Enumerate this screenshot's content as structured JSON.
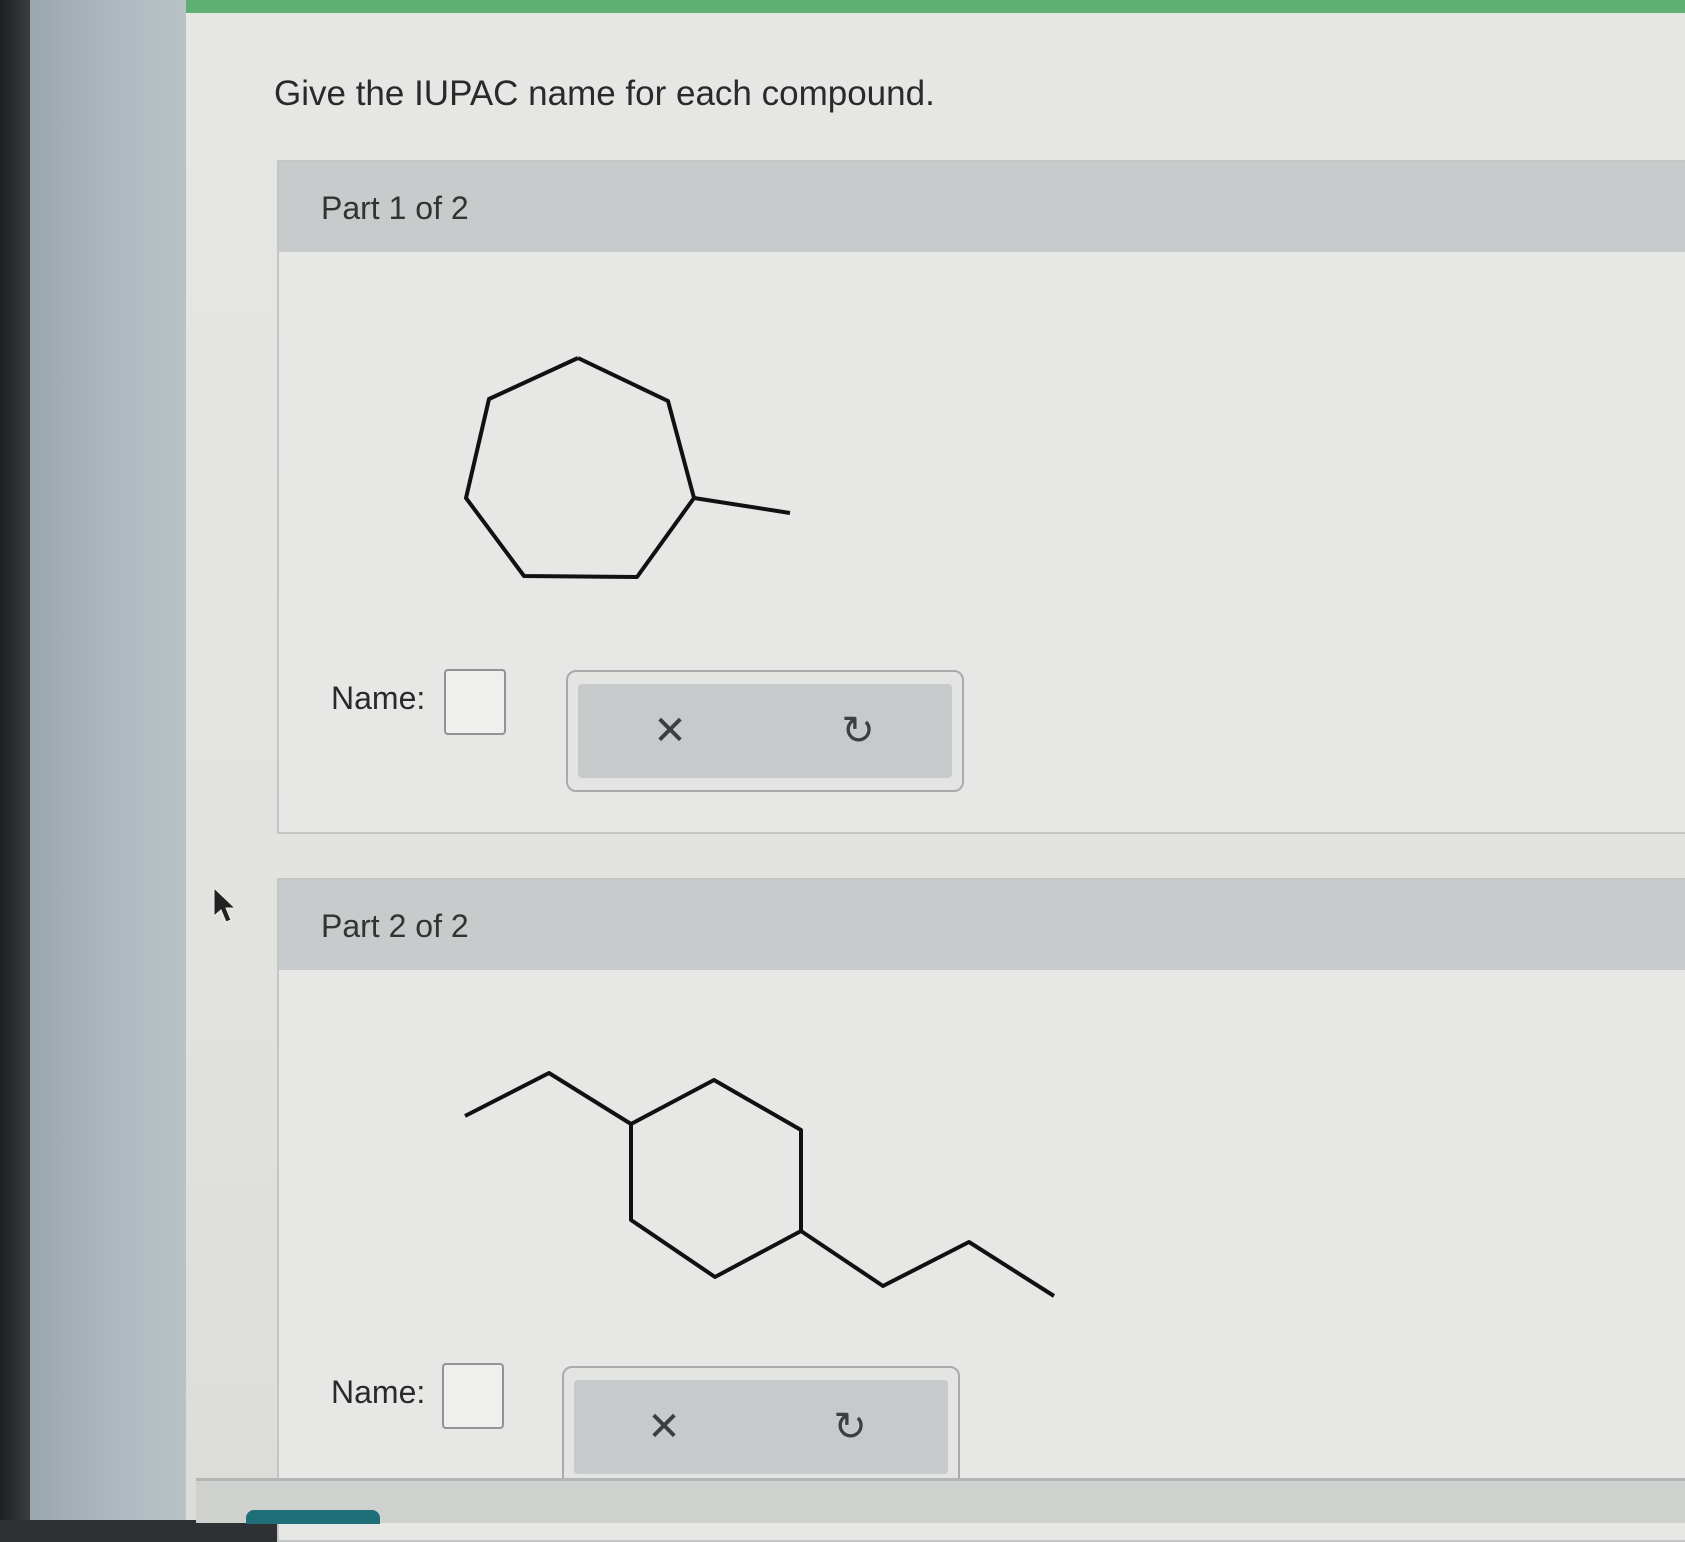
{
  "question": {
    "text": "Give the IUPAC name for each compound."
  },
  "parts": [
    {
      "title": "Part 1 of 2",
      "name_label": "Name:",
      "clear_icon": "close-icon",
      "undo_icon": "undo-icon",
      "clear_glyph": "✕",
      "undo_glyph": "↻"
    },
    {
      "title": "Part 2 of 2",
      "name_label": "Name:",
      "clear_icon": "close-icon",
      "undo_icon": "undo-icon",
      "clear_glyph": "✕",
      "undo_glyph": "↻"
    }
  ],
  "colors": {
    "accent_bar": "#5fae72",
    "part_header": "#c7cbcc"
  }
}
